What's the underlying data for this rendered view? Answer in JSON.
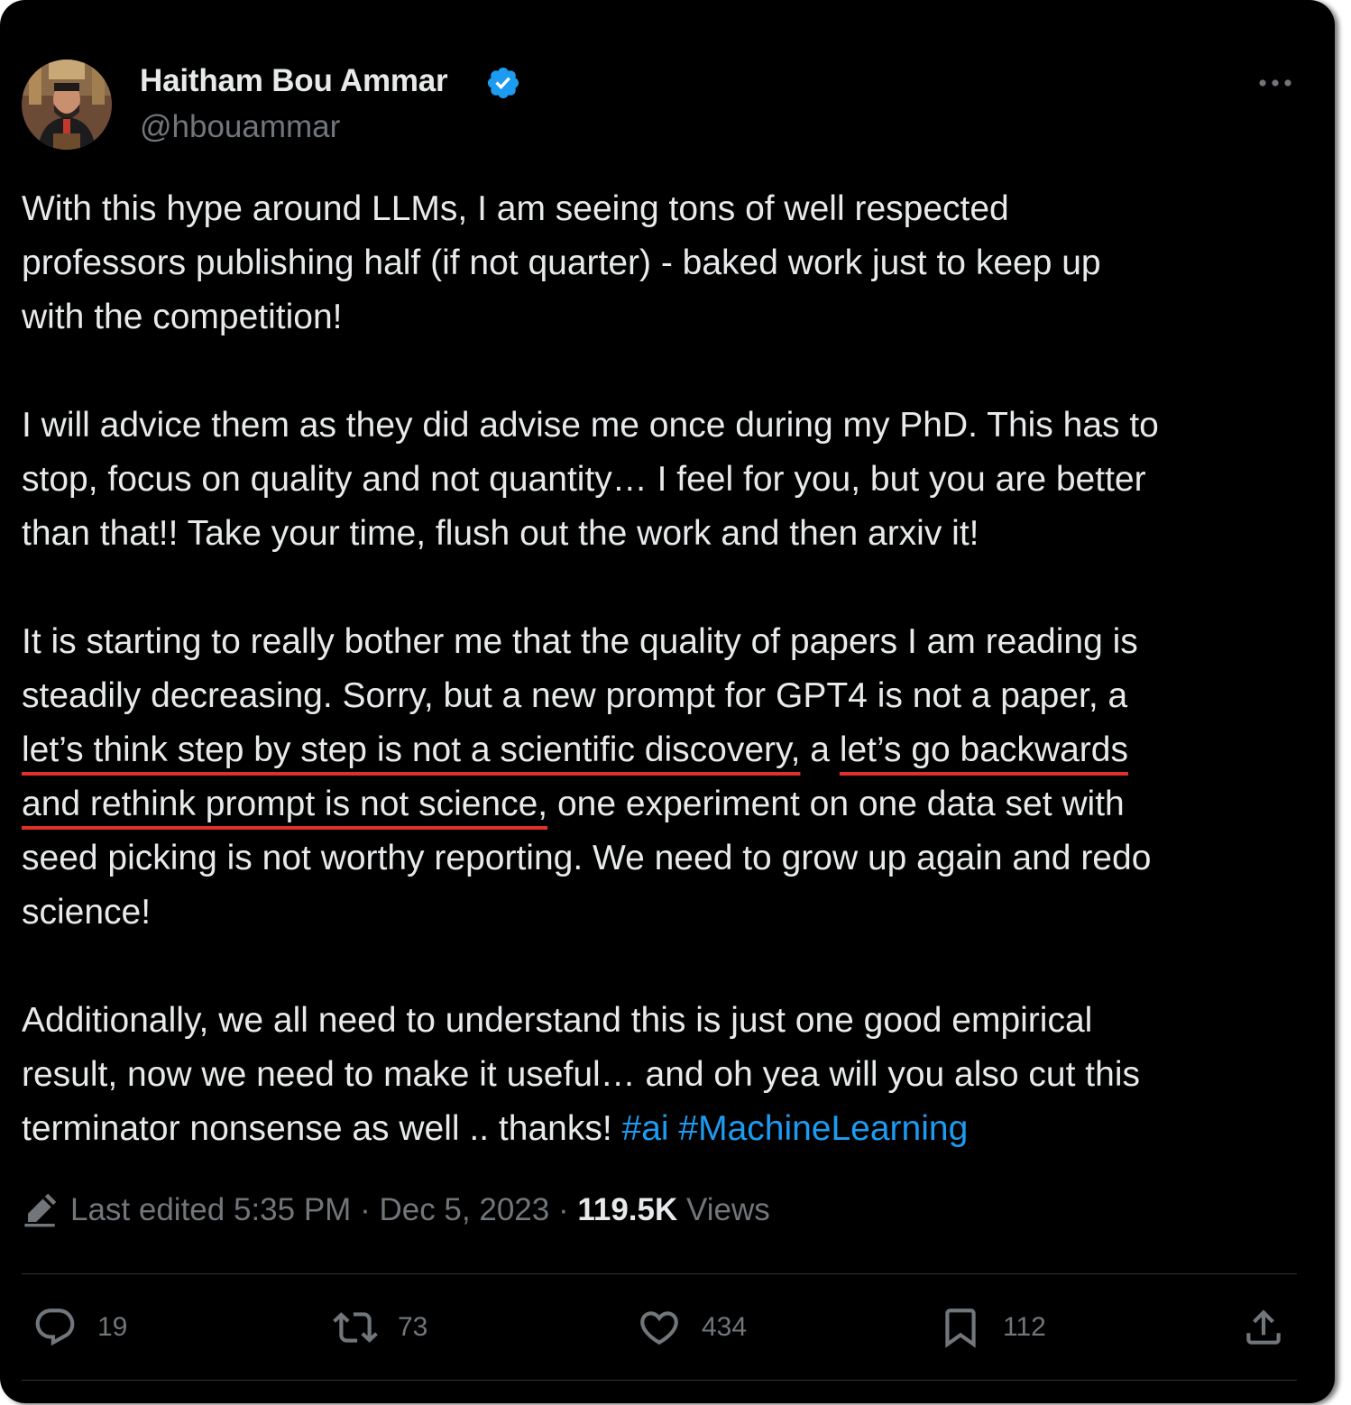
{
  "author": {
    "display_name": "Haitham Bou Ammar",
    "handle": "@hbouammar",
    "verified": true,
    "verified_color": "#1d9bf0"
  },
  "tweet": {
    "paragraph1": [
      "With this hype around LLMs, I am seeing tons of well respected",
      "professors publishing half (if not quarter) - baked work just to keep up",
      "with the competition!"
    ],
    "paragraph2": [
      "I will advice them as they did advise me once during my PhD. This has to",
      "stop, focus on quality and not quantity… I feel for you, but you are better",
      "than that!! Take your time, flush out the work and then arxiv it!"
    ],
    "paragraph3": {
      "line1": "It is starting to really bother me that the quality of papers I am reading is",
      "line2": "steadily decreasing. Sorry, but a new prompt for GPT4 is not a paper, a",
      "line3_underlined_a": "let’s think step by step is not a scientific discovery,",
      "line3_mid": " a ",
      "line3_underlined_b": "let’s go backwards",
      "line4_underlined": "and rethink prompt is not science,",
      "line4_rest": " one experiment on one data set with",
      "line5": "seed picking is not worthy reporting. We need to grow up again and redo",
      "line6": "science!"
    },
    "paragraph4": {
      "line1": "Additionally, we all need to understand this is just one good empirical",
      "line2": "result, now we need to make it useful… and oh yea will you also cut this",
      "line3_text": "terminator nonsense as well .. thanks! ",
      "hashtag1": "#ai",
      "hashtag2": "#MachineLearning"
    },
    "hashtag_color": "#1d9bf0",
    "annotation_color": "#e0302a"
  },
  "meta": {
    "edited_label": "Last edited",
    "time": "5:35 PM",
    "separator": "·",
    "date": "Dec 5, 2023",
    "views_count": "119.5K",
    "views_label": "Views"
  },
  "actions": {
    "replies": "19",
    "reposts": "73",
    "likes": "434",
    "bookmarks": "112"
  },
  "icons": {
    "avatar": "avatar-photo",
    "verified": "verified-badge-icon",
    "more": "more-options-icon",
    "edit": "pencil-icon",
    "reply": "reply-icon",
    "repost": "repost-icon",
    "like": "heart-icon",
    "bookmark": "bookmark-icon",
    "share": "share-icon"
  }
}
